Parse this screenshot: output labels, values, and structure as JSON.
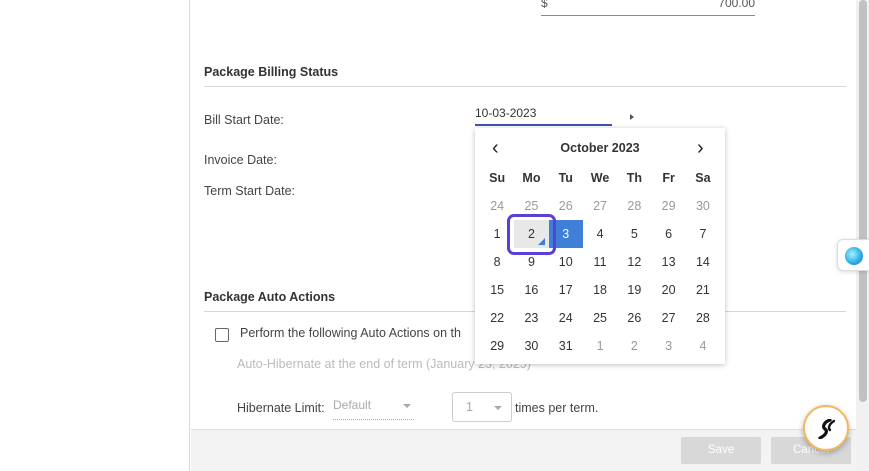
{
  "amount": {
    "currency": "$",
    "value": "700.00"
  },
  "billing_section": {
    "title": "Package Billing Status",
    "bill_start_label": "Bill Start Date:",
    "bill_start_value": "10-03-2023",
    "invoice_label": "Invoice Date:",
    "term_start_label": "Term Start Date:"
  },
  "calendar": {
    "prev": "‹",
    "next": "›",
    "month_title": "October 2023",
    "weekdays": [
      "Su",
      "Mo",
      "Tu",
      "We",
      "Th",
      "Fr",
      "Sa"
    ],
    "weeks": [
      [
        "24",
        "25",
        "26",
        "27",
        "28",
        "29",
        "30"
      ],
      [
        "1",
        "2",
        "3",
        "4",
        "5",
        "6",
        "7"
      ],
      [
        "8",
        "9",
        "10",
        "11",
        "12",
        "13",
        "14"
      ],
      [
        "15",
        "16",
        "17",
        "18",
        "19",
        "20",
        "21"
      ],
      [
        "22",
        "23",
        "24",
        "25",
        "26",
        "27",
        "28"
      ],
      [
        "29",
        "30",
        "31",
        "1",
        "2",
        "3",
        "4"
      ]
    ],
    "selected_day": "3",
    "focused_day": "2",
    "selected_color": "#3f7fd8"
  },
  "auto_actions": {
    "title": "Package Auto Actions",
    "checkbox_label": "Perform the following Auto Actions on th",
    "hibernate_description": "Auto-Hibernate at the end of term (January 23, 2025)",
    "hibernate_limit_label": "Hibernate Limit:",
    "hibernate_limit_value": "Default",
    "times_value": "1",
    "times_label": "times per term."
  },
  "footer": {
    "save_label": "Save",
    "cancel_label": "Cancel"
  },
  "colors": {
    "accent": "#3f51b5",
    "focus_ring": "#5b3fd6"
  }
}
